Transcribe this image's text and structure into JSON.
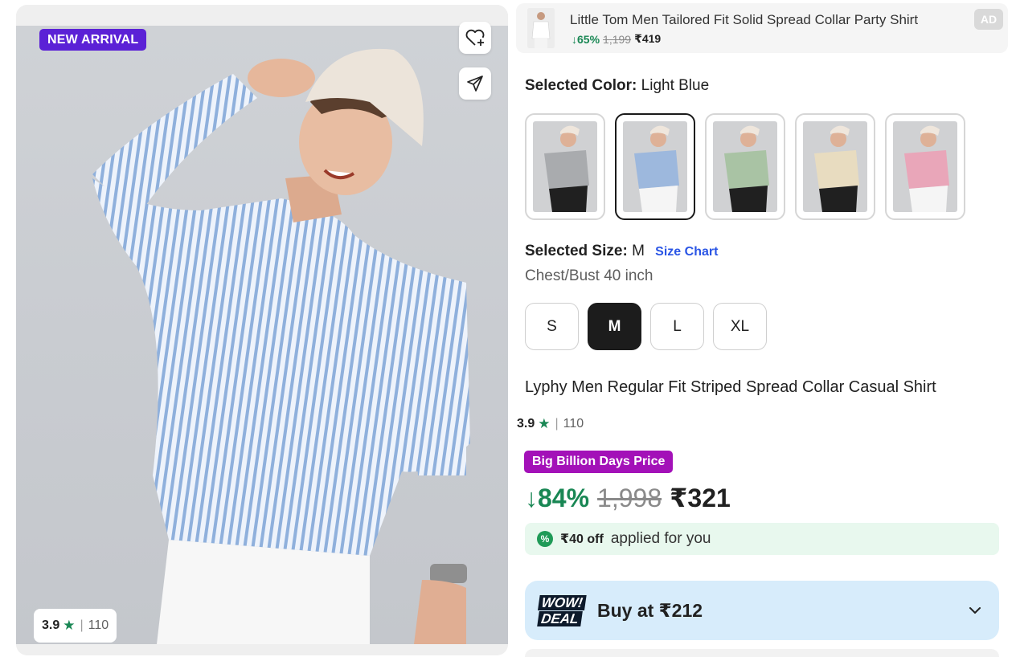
{
  "gallery": {
    "badge": "NEW ARRIVAL",
    "rating": {
      "value": "3.9",
      "count": "110"
    },
    "icons": {
      "wishlist": "heart-plus-icon",
      "share": "share-icon"
    }
  },
  "ad": {
    "title": "Little Tom Men Tailored Fit Solid Spread Collar Party Shirt",
    "discount": "65%",
    "mrp": "1,199",
    "price": "₹419",
    "tag": "AD"
  },
  "color": {
    "label": "Selected Color:",
    "value": "Light Blue",
    "options": [
      {
        "name": "Grey",
        "hex": "#a9abae",
        "active": false
      },
      {
        "name": "Light Blue",
        "hex": "#9db8dd",
        "active": true
      },
      {
        "name": "Green",
        "hex": "#a9c3a4",
        "active": false
      },
      {
        "name": "Cream",
        "hex": "#e8dcc0",
        "active": false
      },
      {
        "name": "Pink",
        "hex": "#e9a6b9",
        "active": false
      }
    ]
  },
  "size": {
    "label": "Selected Size:",
    "value": "M",
    "chart_link": "Size Chart",
    "measure": "Chest/Bust 40 inch",
    "options": [
      "S",
      "M",
      "L",
      "XL"
    ]
  },
  "product": {
    "title": "Lyphy Men Regular Fit Striped Spread Collar Casual Shirt",
    "rating": {
      "value": "3.9",
      "count": "110"
    }
  },
  "pricing": {
    "sale_badge": "Big Billion Days Price",
    "discount": "84%",
    "mrp": "1,998",
    "price": "₹321"
  },
  "coupon": {
    "amount": "₹40 off",
    "text": "applied for you"
  },
  "deal": {
    "logo_top": "WOW!",
    "logo_bottom": "DEAL",
    "text": "Buy at ₹212"
  },
  "colors": {
    "green": "#198754",
    "purple_badge": "#5b21d6",
    "sale_badge": "#a311b8",
    "link_blue": "#2a55e5",
    "deal_bg": "#d7ecfb",
    "coupon_bg": "#e8f8ee"
  }
}
